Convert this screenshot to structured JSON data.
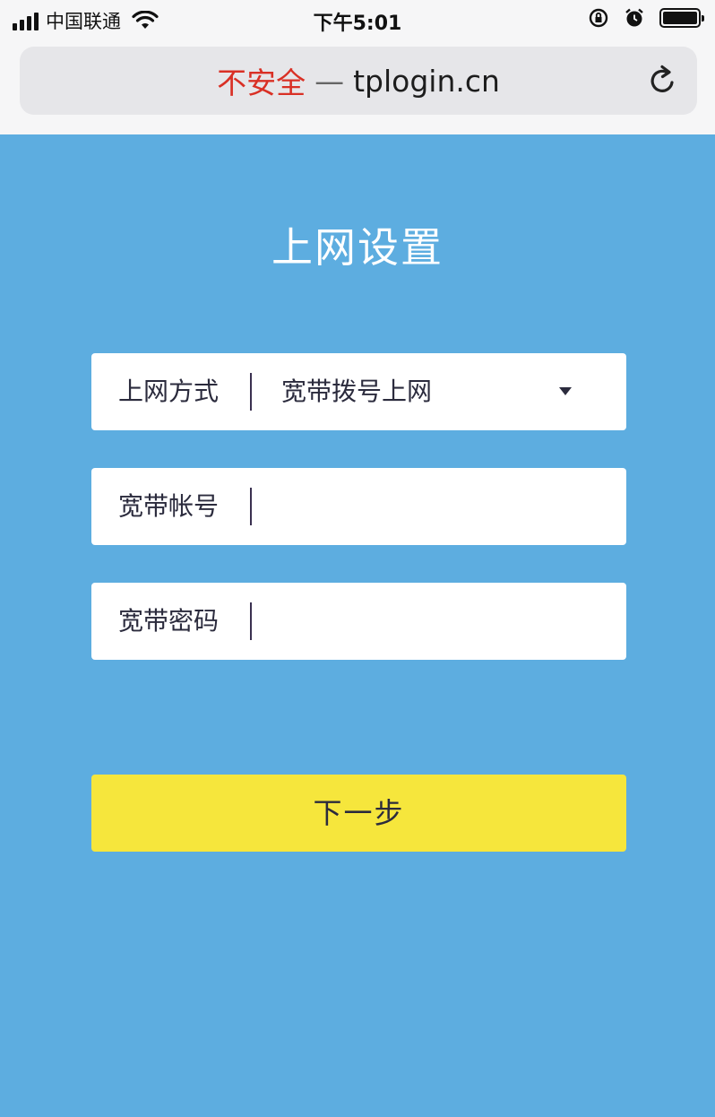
{
  "status_bar": {
    "carrier": "中国联通",
    "time": "下午5:01"
  },
  "browser": {
    "security_label": "不安全",
    "separator": "—",
    "domain": "tplogin.cn"
  },
  "page": {
    "title": "上网设置",
    "fields": [
      {
        "label": "上网方式",
        "value": "宽带拨号上网",
        "type": "select"
      },
      {
        "label": "宽带帐号",
        "value": "",
        "type": "text"
      },
      {
        "label": "宽带密码",
        "value": "",
        "type": "password"
      }
    ],
    "next_label": "下一步"
  },
  "colors": {
    "background": "#5dade0",
    "button": "#f6e63c",
    "insecure": "#d93025"
  },
  "icons": [
    "signal-icon",
    "wifi-icon",
    "lock-rotation-icon",
    "alarm-icon",
    "battery-icon",
    "reload-icon",
    "dropdown-arrow-icon"
  ]
}
